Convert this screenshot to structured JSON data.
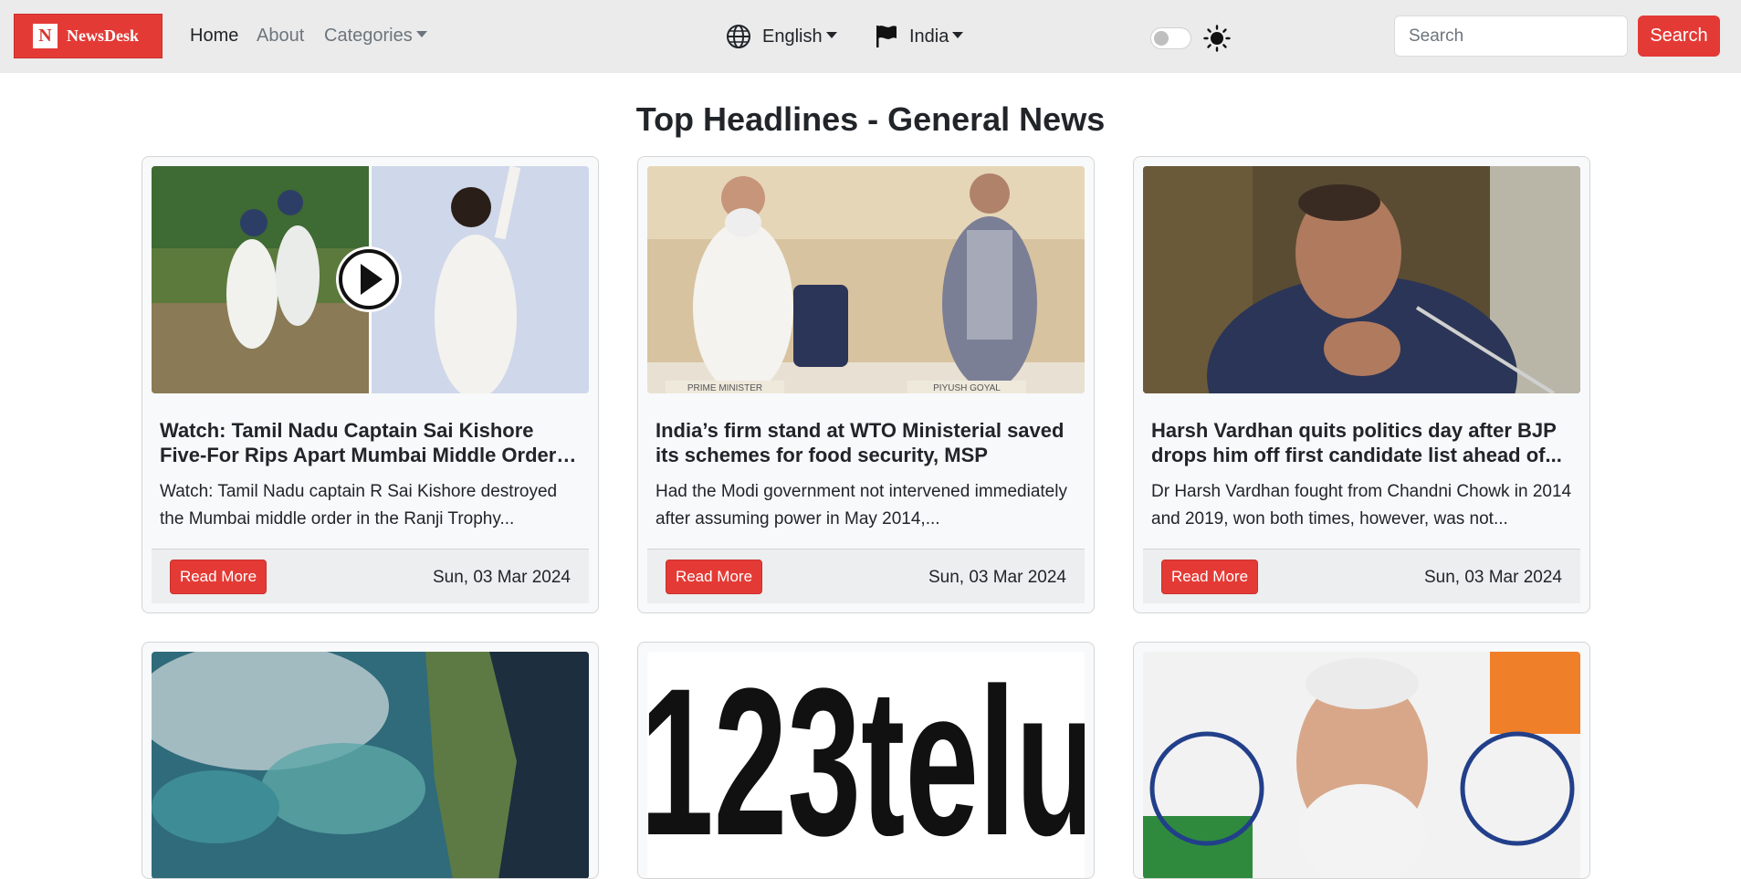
{
  "brand": {
    "logo_letter": "N",
    "name": "NewsDesk",
    "color": "#e43a35"
  },
  "nav": {
    "home": "Home",
    "about": "About",
    "categories": "Categories"
  },
  "language": {
    "selected": "English",
    "icon": "globe-icon"
  },
  "country": {
    "selected": "India",
    "icon": "flag-icon"
  },
  "theme": {
    "toggle_state": "off",
    "icon": "sun-icon"
  },
  "search": {
    "placeholder": "Search",
    "button_label": "Search"
  },
  "main": {
    "title": "Top Headlines - General News"
  },
  "articles": [
    {
      "title": "Watch: Tamil Nadu Captain Sai Kishore Five-For Rips Apart Mumbai Middle Order In...",
      "description": "Watch: Tamil Nadu captain R Sai Kishore destroyed the Mumbai middle order in the Ranji Trophy...",
      "button": "Read More",
      "date": "Sun, 03 Mar 2024",
      "image": "cricket-video-thumbnail"
    },
    {
      "title": "India’s firm stand at WTO Ministerial saved its schemes for food security, MSP",
      "description": "Had the Modi government not intervened immediately after assuming power in May 2014,...",
      "button": "Read More",
      "date": "Sun, 03 Mar 2024",
      "image": "two-leaders-applauding-photo",
      "image_caption_left": "PRIME MINISTER",
      "image_caption_right": "PIYUSH GOYAL"
    },
    {
      "title": "Harsh Vardhan quits politics day after BJP drops him off first candidate list ahead of...",
      "description": "Dr Harsh Vardhan fought from Chandni Chowk in 2014 and 2019, won both times, however, was not...",
      "button": "Read More",
      "date": "Sun, 03 Mar 2024",
      "image": "politician-at-microphone-photo"
    },
    {
      "image": "satellite-coast-photo"
    },
    {
      "image": "123telugu-logo",
      "image_text": "123telu"
    },
    {
      "image": "leader-with-flags-photo"
    }
  ]
}
